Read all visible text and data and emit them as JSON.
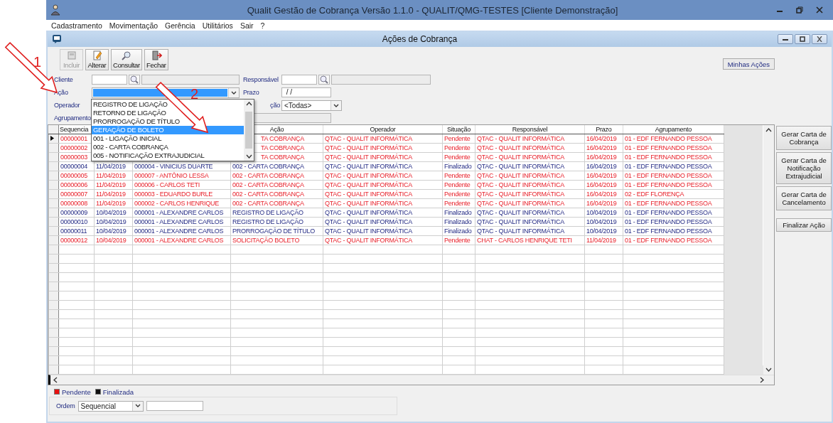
{
  "window": {
    "title": "Qualit Gestão de Cobrança Versão 1.1.0 - QUALIT/QMG-TESTES [Cliente Demonstração]"
  },
  "menu": [
    "Cadastramento",
    "Movimentação",
    "Gerência",
    "Utilitários",
    "Sair",
    "?"
  ],
  "form": {
    "title": "Ações de Cobrança"
  },
  "toolbar": [
    {
      "label": "Incluir",
      "kind": "new",
      "disabled": true
    },
    {
      "label": "Alterar",
      "kind": "edit",
      "disabled": false
    },
    {
      "label": "Consultar",
      "kind": "view",
      "disabled": false
    },
    {
      "label": "Fechar",
      "kind": "close",
      "disabled": false
    }
  ],
  "my_actions_button": "Minhas Ações",
  "filters": {
    "cliente": "Cliente",
    "responsavel": "Responsável",
    "acao": "Ação",
    "prazo": "Prazo",
    "prazo_value": " / /",
    "operador": "Operador",
    "situacao": "ção",
    "situacao_value": "<Todas>",
    "agrupamento": "Agrupamento"
  },
  "dropdown": [
    {
      "label": "REGISTRO DE LIGAÇÃO",
      "selected": false
    },
    {
      "label": "RETORNO DE LIGAÇÃO",
      "selected": false
    },
    {
      "label": "PRORROGAÇÃO DE TÍTULO",
      "selected": false
    },
    {
      "label": "GERAÇÃO DE BOLETO",
      "selected": true
    },
    {
      "label": "001 - LIGAÇÃO INICIAL",
      "selected": false
    },
    {
      "label": "002 - CARTA COBRANÇA",
      "selected": false
    },
    {
      "label": "005 - NOTIFICAÇÃO EXTRAJUDICIAL",
      "selected": false
    }
  ],
  "table": {
    "columns": [
      "Sequencia",
      null,
      null,
      "Ação",
      "Operador",
      "Situação",
      "Responsável",
      "Prazo",
      "Agrupamento"
    ],
    "rows": [
      {
        "current": true,
        "pending": true,
        "cells": [
          "00000001",
          null,
          null,
          "TA COBRANÇA",
          "QTAC - QUALIT INFORMÁTICA",
          "Pendente",
          "QTAC - QUALIT INFORMÁTICA",
          "16/04/2019",
          "01 - EDF FERNANDO PESSOA"
        ]
      },
      {
        "current": false,
        "pending": true,
        "cells": [
          "00000002",
          null,
          null,
          "TA COBRANÇA",
          "QTAC - QUALIT INFORMÁTICA",
          "Pendente",
          "QTAC - QUALIT INFORMÁTICA",
          "16/04/2019",
          "01 - EDF FERNANDO PESSOA"
        ]
      },
      {
        "current": false,
        "pending": true,
        "cells": [
          "00000003",
          null,
          null,
          "TA COBRANÇA",
          "QTAC - QUALIT INFORMÁTICA",
          "Pendente",
          "QTAC - QUALIT INFORMÁTICA",
          "16/04/2019",
          "01 - EDF FERNANDO PESSOA"
        ]
      },
      {
        "current": false,
        "pending": false,
        "cells": [
          "00000004",
          "11/04/2019",
          "000004 - VINICIUS DUARTE",
          "002 - CARTA COBRANÇA",
          "QTAC - QUALIT INFORMÁTICA",
          "Finalizado",
          "QTAC - QUALIT INFORMÁTICA",
          "16/04/2019",
          "01 - EDF FERNANDO PESSOA"
        ]
      },
      {
        "current": false,
        "pending": true,
        "cells": [
          "00000005",
          "11/04/2019",
          "000007 - ANTÔNIO LESSA",
          "002 - CARTA COBRANÇA",
          "QTAC - QUALIT INFORMÁTICA",
          "Pendente",
          "QTAC - QUALIT INFORMÁTICA",
          "16/04/2019",
          "01 - EDF FERNANDO PESSOA"
        ]
      },
      {
        "current": false,
        "pending": true,
        "cells": [
          "00000006",
          "11/04/2019",
          "000006 - CARLOS TETI",
          "002 - CARTA COBRANÇA",
          "QTAC - QUALIT INFORMÁTICA",
          "Pendente",
          "QTAC - QUALIT INFORMÁTICA",
          "16/04/2019",
          "01 - EDF FERNANDO PESSOA"
        ]
      },
      {
        "current": false,
        "pending": true,
        "cells": [
          "00000007",
          "11/04/2019",
          "000003 - EDUARDO BURLE",
          "002 - CARTA COBRANÇA",
          "QTAC - QUALIT INFORMÁTICA",
          "Pendente",
          "QTAC - QUALIT INFORMÁTICA",
          "16/04/2019",
          "02 - EDF FLORENÇA"
        ]
      },
      {
        "current": false,
        "pending": true,
        "cells": [
          "00000008",
          "11/04/2019",
          "000002 - CARLOS HENRIQUE",
          "002 - CARTA COBRANÇA",
          "QTAC - QUALIT INFORMÁTICA",
          "Pendente",
          "QTAC - QUALIT INFORMÁTICA",
          "16/04/2019",
          "01 - EDF FERNANDO PESSOA"
        ]
      },
      {
        "current": false,
        "pending": false,
        "cells": [
          "00000009",
          "10/04/2019",
          "000001 - ALEXANDRE CARLOS",
          "REGISTRO DE LIGAÇÃO",
          "QTAC - QUALIT INFORMÁTICA",
          "Finalizado",
          "QTAC - QUALIT INFORMÁTICA",
          "10/04/2019",
          "01 - EDF FERNANDO PESSOA"
        ]
      },
      {
        "current": false,
        "pending": false,
        "cells": [
          "00000010",
          "10/04/2019",
          "000001 - ALEXANDRE CARLOS",
          "REGISTRO DE LIGAÇÃO",
          "QTAC - QUALIT INFORMÁTICA",
          "Finalizado",
          "QTAC - QUALIT INFORMÁTICA",
          "10/04/2019",
          "01 - EDF FERNANDO PESSOA"
        ]
      },
      {
        "current": false,
        "pending": false,
        "cells": [
          "00000011",
          "10/04/2019",
          "000001 - ALEXANDRE CARLOS",
          "PRORROGAÇÃO DE TÍTULO",
          "QTAC - QUALIT INFORMÁTICA",
          "Finalizado",
          "QTAC - QUALIT INFORMÁTICA",
          "10/04/2019",
          "01 - EDF FERNANDO PESSOA"
        ]
      },
      {
        "current": false,
        "pending": true,
        "cells": [
          "00000012",
          "10/04/2019",
          "000001 - ALEXANDRE CARLOS",
          "SOLICITAÇÃO BOLETO",
          "QTAC - QUALIT INFORMÁTICA",
          "Pendente",
          "CHAT - CARLOS HENRIQUE TETI",
          "11/04/2019",
          "01 - EDF FERNANDO PESSOA"
        ]
      }
    ]
  },
  "side_buttons": [
    "Gerar Carta de Cobrança",
    "Gerar Carta de Notificação Extrajudicial",
    "Gerar Carta de Cancelamento",
    "Finalizar Ação"
  ],
  "legend": [
    {
      "label": "Pendente",
      "color": "#e81010"
    },
    {
      "label": "Finalizada",
      "color": "#101010"
    }
  ],
  "order": {
    "label": "Ordem",
    "value": "Sequencial"
  },
  "annotations": [
    {
      "label": "1"
    },
    {
      "label": "2"
    }
  ]
}
